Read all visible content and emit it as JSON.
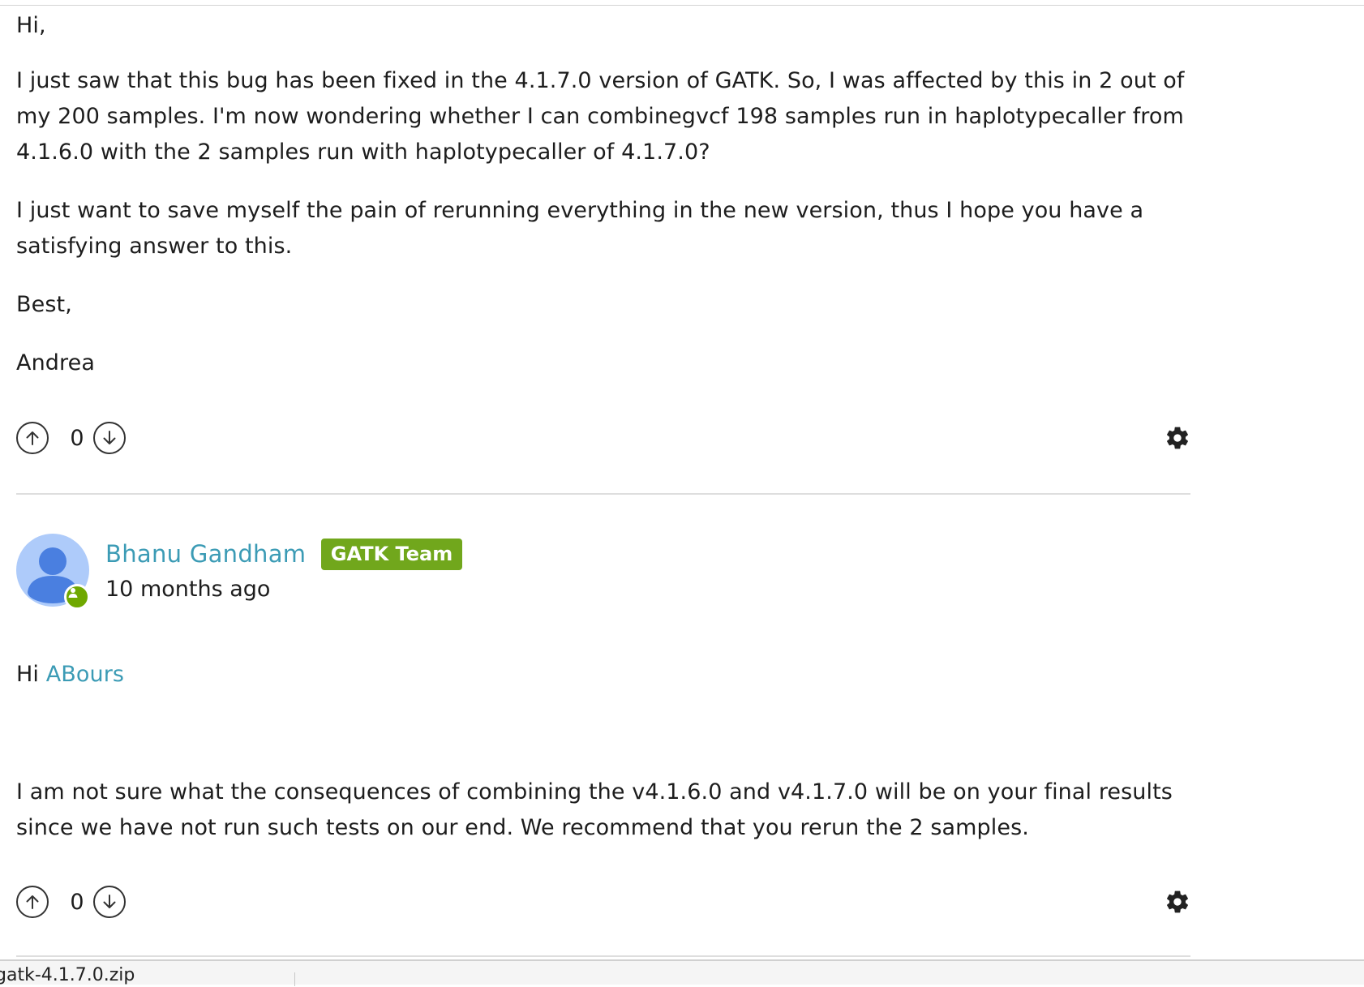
{
  "post1": {
    "paragraphs": [
      "Hi,",
      "I just saw that this bug has been fixed in the 4.1.7.0 version of GATK. So, I was affected by this in 2 out of my 200 samples. I'm now wondering whether I can combinegvcf 198 samples run in haplotypecaller from 4.1.6.0 with the 2 samples run with haplotypecaller of 4.1.7.0?",
      "I just want to save myself the pain of rerunning everything in the new version, thus I hope you have a satisfying answer to this.",
      "Best,",
      "Andrea"
    ],
    "vote_count": "0"
  },
  "post2": {
    "author": "Bhanu Gandham",
    "badge": "GATK Team",
    "timestamp": "10 months ago",
    "greeting": "Hi",
    "mention": "ABours",
    "body": "I am not sure what the consequences of combining the v4.1.6.0 and v4.1.7.0 will be on your final results since we have not run such tests on our end. We recommend that you rerun the 2 samples.",
    "vote_count": "0"
  },
  "icons": {
    "upvote": "arrow-up-circle-icon",
    "downvote": "arrow-down-circle-icon",
    "settings": "gear-icon",
    "avatar": "user-avatar-icon",
    "badge": "person-badge-icon"
  },
  "colors": {
    "link": "#3b9bb5",
    "badge_bg": "#71a71c",
    "avatar_bg": "#aecbfa",
    "avatar_figure": "#4a7fe0"
  },
  "download_bar": {
    "filename": "gatk-4.1.7.0.zip"
  }
}
